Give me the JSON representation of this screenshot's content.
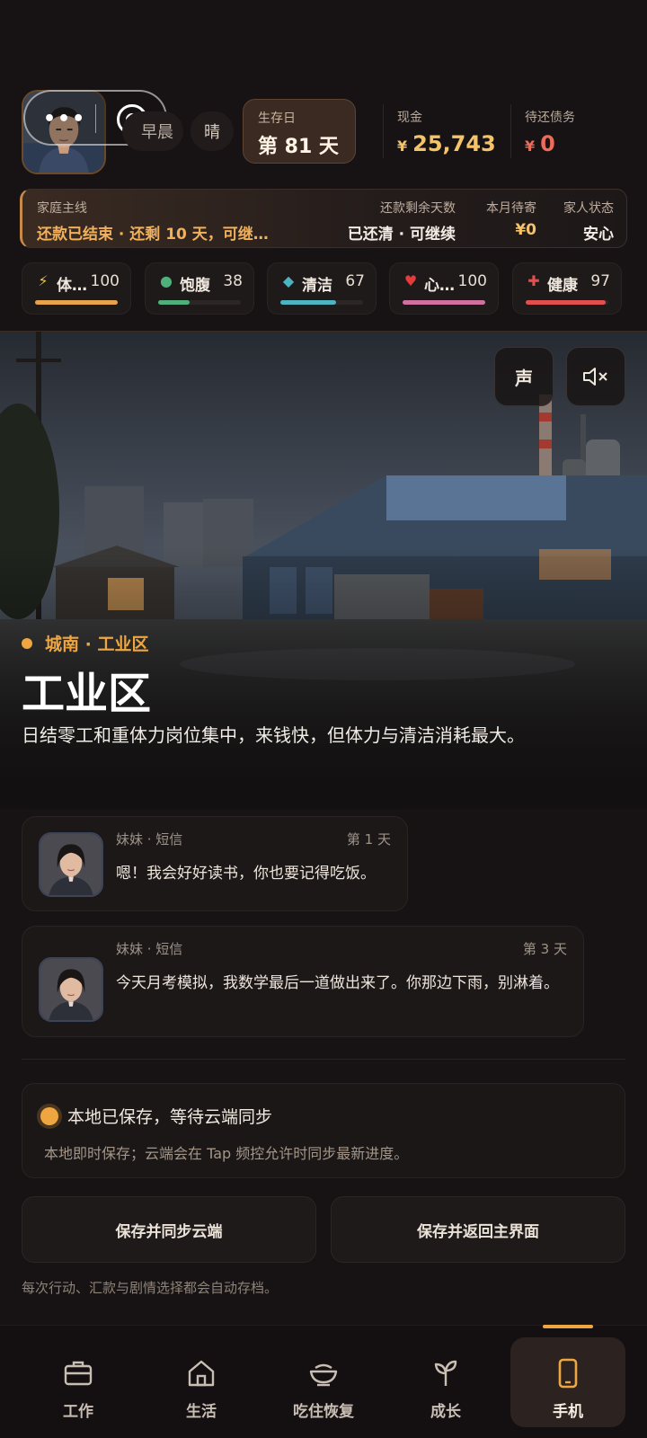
{
  "header": {
    "time_of_day": "早晨",
    "weather": "晴",
    "day_label": "生存日",
    "day_value": "第 81 天",
    "cash_label": "现金",
    "cash_currency": "¥",
    "cash_value": "25,743",
    "debt_label": "待还债务",
    "debt_currency": "¥",
    "debt_value": "0"
  },
  "family": {
    "main_label": "家庭主线",
    "main_value": "还款已结束 · 还剩 10 天，可继…",
    "days_label": "还款剩余天数",
    "days_value": "已还清 · 可继续",
    "send_label": "本月待寄",
    "send_value": "¥0",
    "status_label": "家人状态",
    "status_value": "安心"
  },
  "stats": [
    {
      "icon": "lightning-icon",
      "glyph": "⚡",
      "name": "体…",
      "value": "100",
      "level": 1.0,
      "color": "#e8a24e"
    },
    {
      "icon": "circle-icon",
      "glyph": "●",
      "name": "饱腹",
      "value": "38",
      "level": 0.38,
      "color": "#4fb07c"
    },
    {
      "icon": "diamond-icon",
      "glyph": "◆",
      "name": "清洁",
      "value": "67",
      "level": 0.67,
      "color": "#4db3c0"
    },
    {
      "icon": "heart-icon",
      "glyph": "♥",
      "name": "心…",
      "value": "100",
      "level": 1.0,
      "color": "#d0709e"
    },
    {
      "icon": "plus-icon",
      "glyph": "✚",
      "name": "健康",
      "value": "97",
      "level": 0.97,
      "color": "#e24f4f"
    }
  ],
  "scene": {
    "sound_label": "声",
    "mute_label": "◁×",
    "location": "城南 · 工业区",
    "title": "工业区",
    "description": "日结零工和重体力岗位集中，来钱快，但体力与清洁消耗最大。"
  },
  "messages": [
    {
      "source": "妹妹 · 短信",
      "day": "第 1 天",
      "text": "嗯！我会好好读书，你也要记得吃饭。"
    },
    {
      "source": "妹妹 · 短信",
      "day": "第 3 天",
      "text": "今天月考模拟，我数学最后一道做出来了。你那边下雨，别淋着。"
    }
  ],
  "save": {
    "status": "本地已保存，等待云端同步",
    "detail": "本地即时保存；云端会在 Tap 频控允许时同步最新进度。",
    "sync_button": "保存并同步云端",
    "return_button": "保存并返回主界面",
    "note": "每次行动、汇款与剧情选择都会自动存档。"
  },
  "nav": [
    {
      "icon": "briefcase-icon",
      "label": "工作"
    },
    {
      "icon": "home-icon",
      "label": "生活"
    },
    {
      "icon": "bowl-icon",
      "label": "吃住恢复"
    },
    {
      "icon": "sprout-icon",
      "label": "成长"
    },
    {
      "icon": "phone-icon",
      "label": "手机"
    }
  ],
  "colors": {
    "accent": "#f0a640",
    "cash": "#f5c469",
    "debt": "#ef6a58"
  }
}
